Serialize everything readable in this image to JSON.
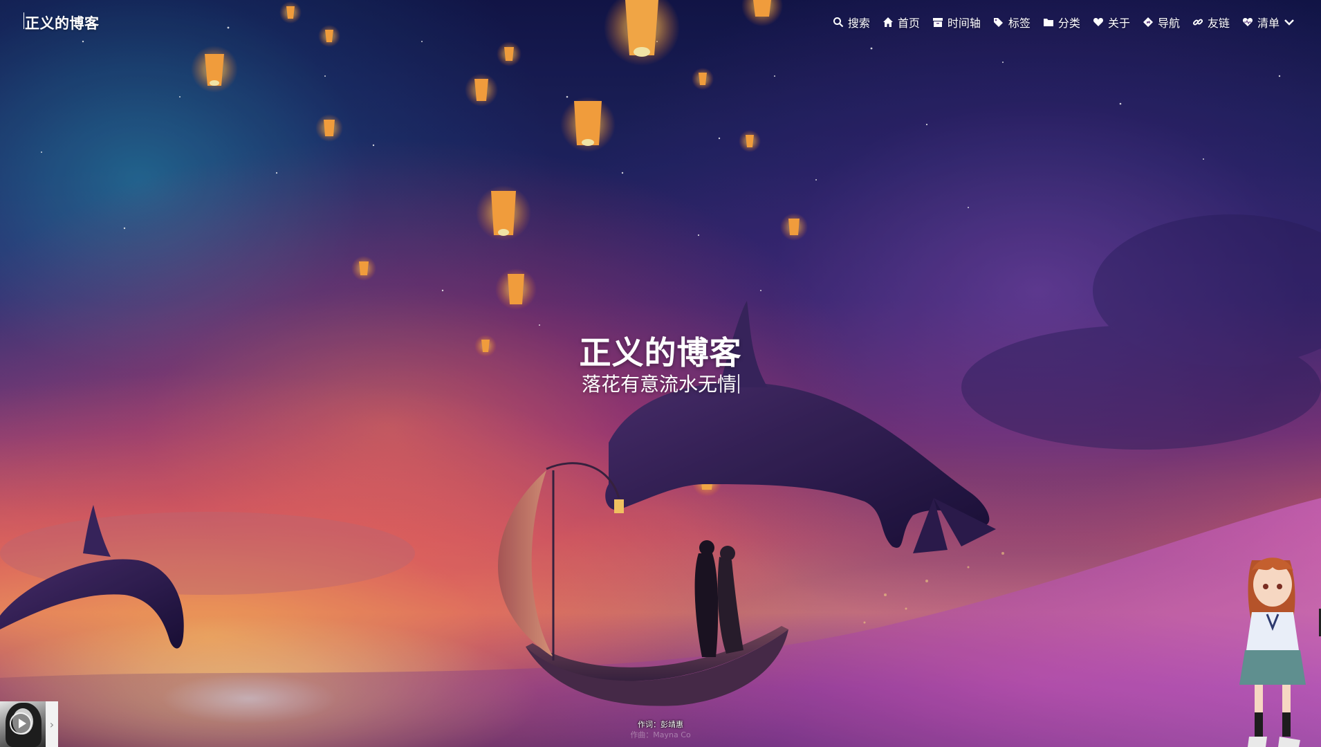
{
  "site": {
    "brand": "正义的博客",
    "hero_title": "正义的博客",
    "hero_subtitle": "落花有意流水无情"
  },
  "nav": {
    "items": [
      {
        "label": "搜索",
        "icon": "search-icon"
      },
      {
        "label": "首页",
        "icon": "home-icon"
      },
      {
        "label": "时间轴",
        "icon": "archive-icon"
      },
      {
        "label": "标签",
        "icon": "tags-icon"
      },
      {
        "label": "分类",
        "icon": "folder-icon"
      },
      {
        "label": "关于",
        "icon": "heart-icon"
      },
      {
        "label": "导航",
        "icon": "directions-icon"
      },
      {
        "label": "友链",
        "icon": "link-icon"
      },
      {
        "label": "清单",
        "icon": "heartbeat-icon"
      }
    ]
  },
  "player": {
    "lyric_line_1": "作词：彭靖惠",
    "lyric_line_2": "作曲：Mayna Co",
    "icons": {
      "play": "play-icon",
      "expand": "chevron-right-icon"
    }
  },
  "colors": {
    "text": "#ffffff",
    "sky_top": "#13164a",
    "sunset": "#e8956a",
    "sea": "#7b3d8e"
  }
}
